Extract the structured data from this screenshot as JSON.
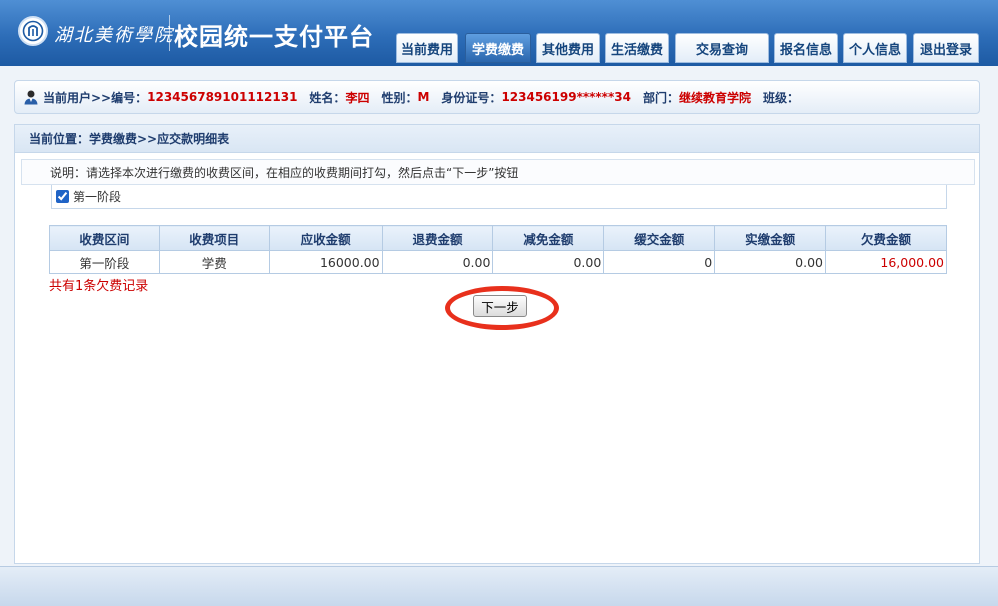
{
  "header": {
    "school_name": "湖北美術學院",
    "platform_title": "校园统一支付平台",
    "nav": [
      {
        "label": "当前费用",
        "active": false
      },
      {
        "label": "学费缴费",
        "active": true
      },
      {
        "label": "其他费用",
        "active": false
      },
      {
        "label": "生活缴费",
        "active": false
      },
      {
        "label": "交易查询",
        "active": false
      },
      {
        "label": "报名信息",
        "active": false
      },
      {
        "label": "个人信息",
        "active": false
      },
      {
        "label": "退出登录",
        "active": false
      }
    ]
  },
  "userbar": {
    "current_user_label": "当前用户>>编号：",
    "id_value": "123456789101112131",
    "name_label": "姓名：",
    "name_value": "李四",
    "gender_label": "性别：",
    "gender_value": "M",
    "idcard_label": "身份证号：",
    "idcard_value": "123456199******34",
    "dept_label": "部门：",
    "dept_value": "继续教育学院",
    "class_label": "班级："
  },
  "content": {
    "breadcrumb": "当前位置：学费缴费>>应交款明细表",
    "instruction": "说明：请选择本次进行缴费的收费区间，在相应的收费期间打勾，然后点击“下一步”按钮",
    "phase_label": "第一阶段",
    "phase_checked": true,
    "table": {
      "headers": [
        "收费区间",
        "收费项目",
        "应收金额",
        "退费金额",
        "减免金额",
        "缓交金额",
        "实缴金额",
        "欠费金额"
      ],
      "rows": [
        [
          "第一阶段",
          "学费",
          "16000.00",
          "0.00",
          "0.00",
          "0",
          "0.00",
          "16,000.00"
        ]
      ]
    },
    "summary": "共有1条欠费记录",
    "next_button": "下一步"
  },
  "colors": {
    "header_blue": "#2d6db8",
    "accent_red": "#cc0000",
    "highlight_ring": "#e8301c"
  }
}
